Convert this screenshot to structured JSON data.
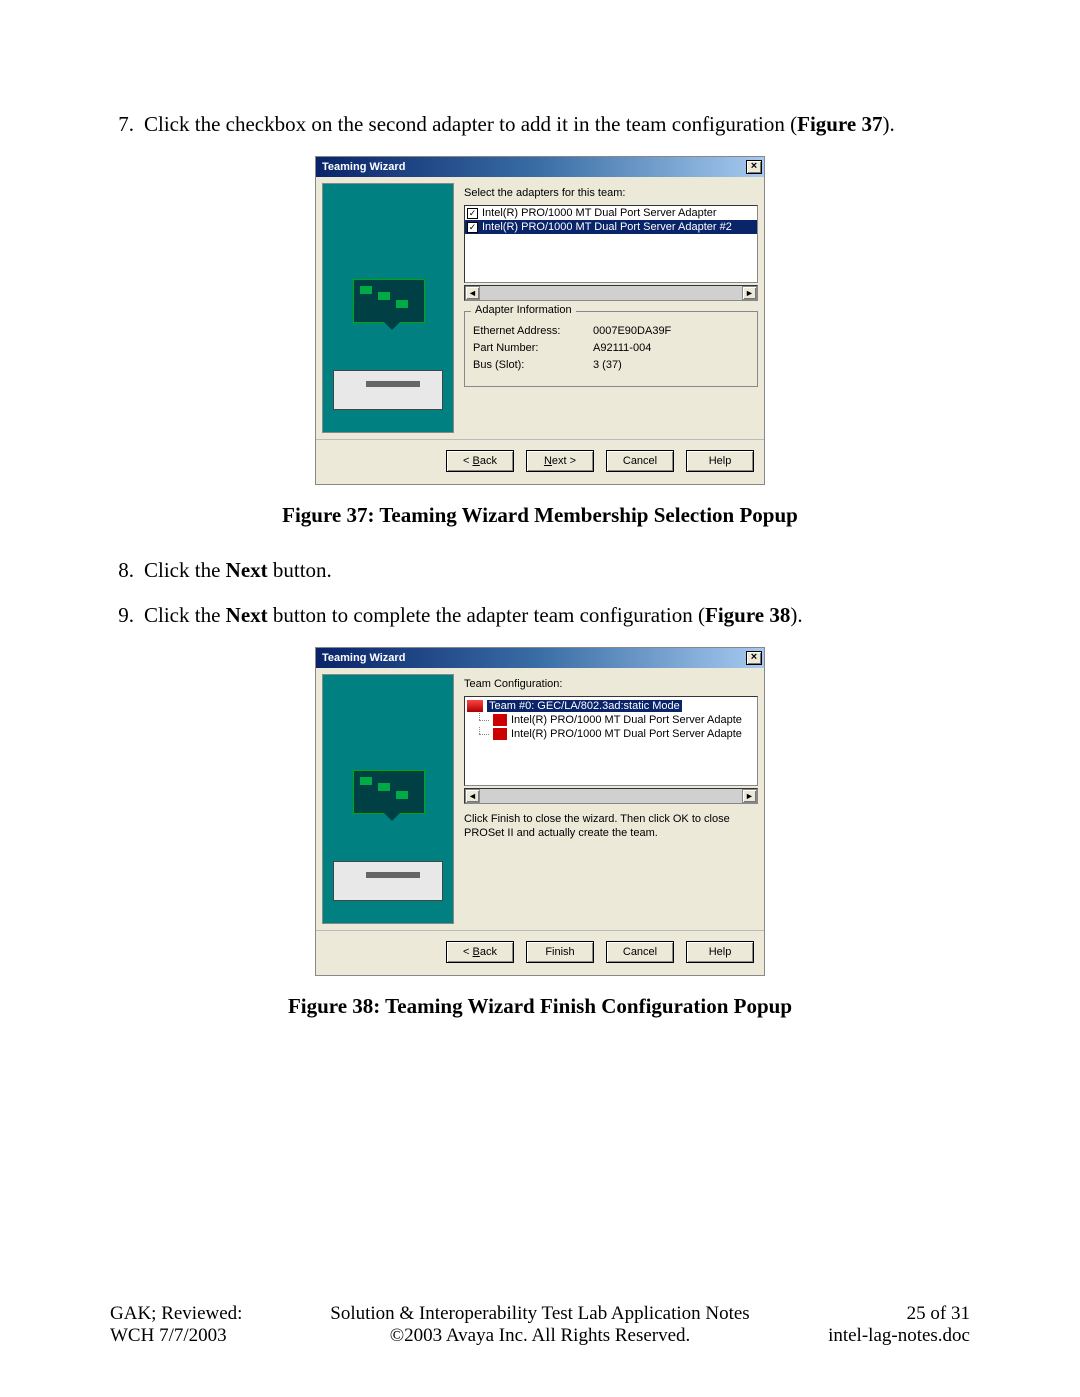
{
  "steps": {
    "s7": {
      "num": "7.",
      "pre": "Click the checkbox on the second adapter to add it in the team configuration (",
      "bold": "Figure 37",
      "post": ")."
    },
    "s8": {
      "num": "8.",
      "pre": "Click the ",
      "bold": "Next",
      "post": " button."
    },
    "s9": {
      "num": "9.",
      "pre": "Click the ",
      "bold": "Next",
      "post2": " button to complete the adapter team configuration (",
      "bold2": "Figure 38",
      "post3": ")."
    }
  },
  "fig37": {
    "title": "Teaming Wizard",
    "close": "×",
    "prompt": "Select the adapters for this team:",
    "adapters": [
      {
        "label": "Intel(R) PRO/1000 MT Dual Port Server Adapter",
        "checked": true,
        "selected": false
      },
      {
        "label": "Intel(R) PRO/1000 MT Dual Port Server Adapter #2",
        "checked": true,
        "selected": true
      }
    ],
    "scroll": {
      "left": "◄",
      "right": "►"
    },
    "group": {
      "legend": "Adapter Information",
      "rows": [
        {
          "k": "Ethernet Address:",
          "v": "0007E90DA39F"
        },
        {
          "k": "Part Number:",
          "v": "A92111-004"
        },
        {
          "k": "Bus (Slot):",
          "v": "3 (37)"
        }
      ]
    },
    "buttons": {
      "back_pre": "< ",
      "back_u": "B",
      "back_post": "ack",
      "next_u": "N",
      "next_post": "ext >",
      "cancel": "Cancel",
      "help": "Help"
    },
    "caption": "Figure 37: Teaming Wizard Membership Selection Popup"
  },
  "fig38": {
    "title": "Teaming Wizard",
    "close": "×",
    "prompt": "Team Configuration:",
    "tree": {
      "root": "Team #0: GEC/LA/802.3ad:static Mode",
      "children": [
        "Intel(R) PRO/1000 MT Dual Port Server Adapte",
        "Intel(R) PRO/1000 MT Dual Port Server Adapte"
      ]
    },
    "scroll": {
      "left": "◄",
      "right": "►"
    },
    "helper": "Click Finish to close the wizard. Then click OK to close PROSet II and actually create the team.",
    "buttons": {
      "back_pre": "< ",
      "back_u": "B",
      "back_post": "ack",
      "finish": "Finish",
      "cancel": "Cancel",
      "help": "Help"
    },
    "caption": "Figure 38: Teaming Wizard Finish Configuration Popup"
  },
  "footer": {
    "left1": "GAK; Reviewed:",
    "left2": "WCH 7/7/2003",
    "center1": "Solution & Interoperability Test Lab Application Notes",
    "center2": "©2003 Avaya Inc. All Rights Reserved.",
    "right1": "25 of 31",
    "right2": "intel-lag-notes.doc"
  }
}
